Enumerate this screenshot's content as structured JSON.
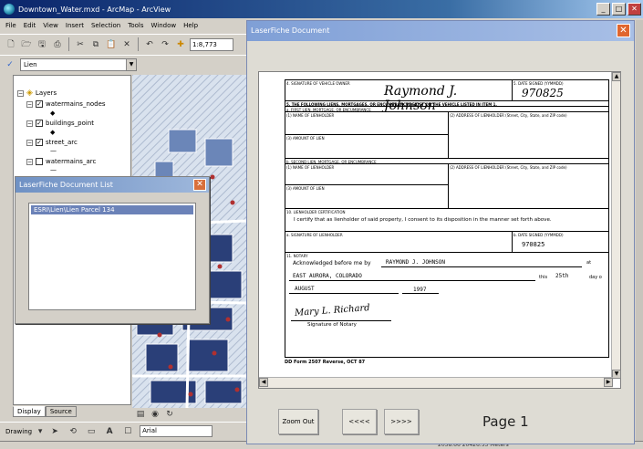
{
  "arcmap": {
    "title": "Downtown_Water.mxd - ArcMap - ArcView",
    "menu": [
      "File",
      "Edit",
      "View",
      "Insert",
      "Selection",
      "Tools",
      "Window",
      "Help"
    ],
    "scale": "1:8,773",
    "layer_dropdown": "Lien",
    "toc": {
      "root": "Layers",
      "layers": [
        {
          "name": "watermains_nodes",
          "checked": true,
          "symbol": "◆"
        },
        {
          "name": "buildings_point",
          "checked": true,
          "symbol": "◆"
        },
        {
          "name": "street_arc",
          "checked": true,
          "symbol": "—"
        },
        {
          "name": "watermains_arc",
          "checked": false,
          "symbol": "—"
        }
      ],
      "tabs": [
        "Display",
        "Source"
      ]
    },
    "drawing_label": "Drawing",
    "font": "Arial",
    "status_text": "2058.66  20426.53 Meters"
  },
  "doc_list": {
    "title": "LaserFiche Document List",
    "items": [
      "ESRI\\Lien\\Lien Parcel 134"
    ]
  },
  "lf_doc": {
    "title": "LaserFiche Document",
    "buttons": {
      "zoom_out": "Zoom Out",
      "prev": "<<<<",
      "next": ">>>>"
    },
    "page_label": "Page 1",
    "form": {
      "sig_owner_label": "4. SIGNATURE OF VEHICLE OWNER",
      "sig_owner_value": "Raymond J. Johnson",
      "date_signed_label": "5. DATE SIGNED (YYMMDD)",
      "date_signed_value": "970825",
      "section5": "5. THE FOLLOWING LIENS, MORTGAGES, OR ENCUMBRANCES EXIST ON THE VEHICLE LISTED IN ITEM 1.",
      "first_lien": "a. FIRST LIEN, MORTGAGE, OR ENCUMBRANCE",
      "name_lienholder_1": "(1) NAME OF LIENHOLDER",
      "address_lienholder_1": "(2) ADDRESS OF LIENHOLDER (Street, City, State, and ZIP code)",
      "amount_lien_1": "(3) AMOUNT OF LIEN",
      "second_lien": "b. SECOND LIEN, MORTGAGE, OR ENCUMBRANCE",
      "name_lienholder_2": "(1) NAME OF LIENHOLDER",
      "address_lienholder_2": "(2) ADDRESS OF LIENHOLDER (Street, City, State, and ZIP code)",
      "amount_lien_2": "(3) AMOUNT OF LIEN",
      "section10": "10. LIENHOLDER CERTIFICATION",
      "certify_text": "I certify that as lienholder of said property, I consent to its disposition in the manner set forth above.",
      "sig_lienholder_label": "a. SIGNATURE OF LIENHOLDER",
      "date_signed2_label": "b. DATE SIGNED (YYMMDD)",
      "date_signed2_value": "970825",
      "notary_label": "11. NOTARY",
      "ack_text": "Acknowledged before me by",
      "ack_name": "RAYMOND J. JOHNSON",
      "at_label": "at",
      "place": "EAST AURORA, COLORADO",
      "this_label": "this",
      "day": "25th",
      "day_of": "day o",
      "month": "AUGUST",
      "year": "1997",
      "notary_sig": "Mary L. Richard",
      "notary_sig_label": "Signature of Notary",
      "form_number": "DD Form 2507 Reverse, OCT 87"
    }
  },
  "colors": {
    "titlebar": "#0a246a",
    "lf_title": "#7f9fd6",
    "close": "#e0662e",
    "selection": "#6b82b8"
  }
}
